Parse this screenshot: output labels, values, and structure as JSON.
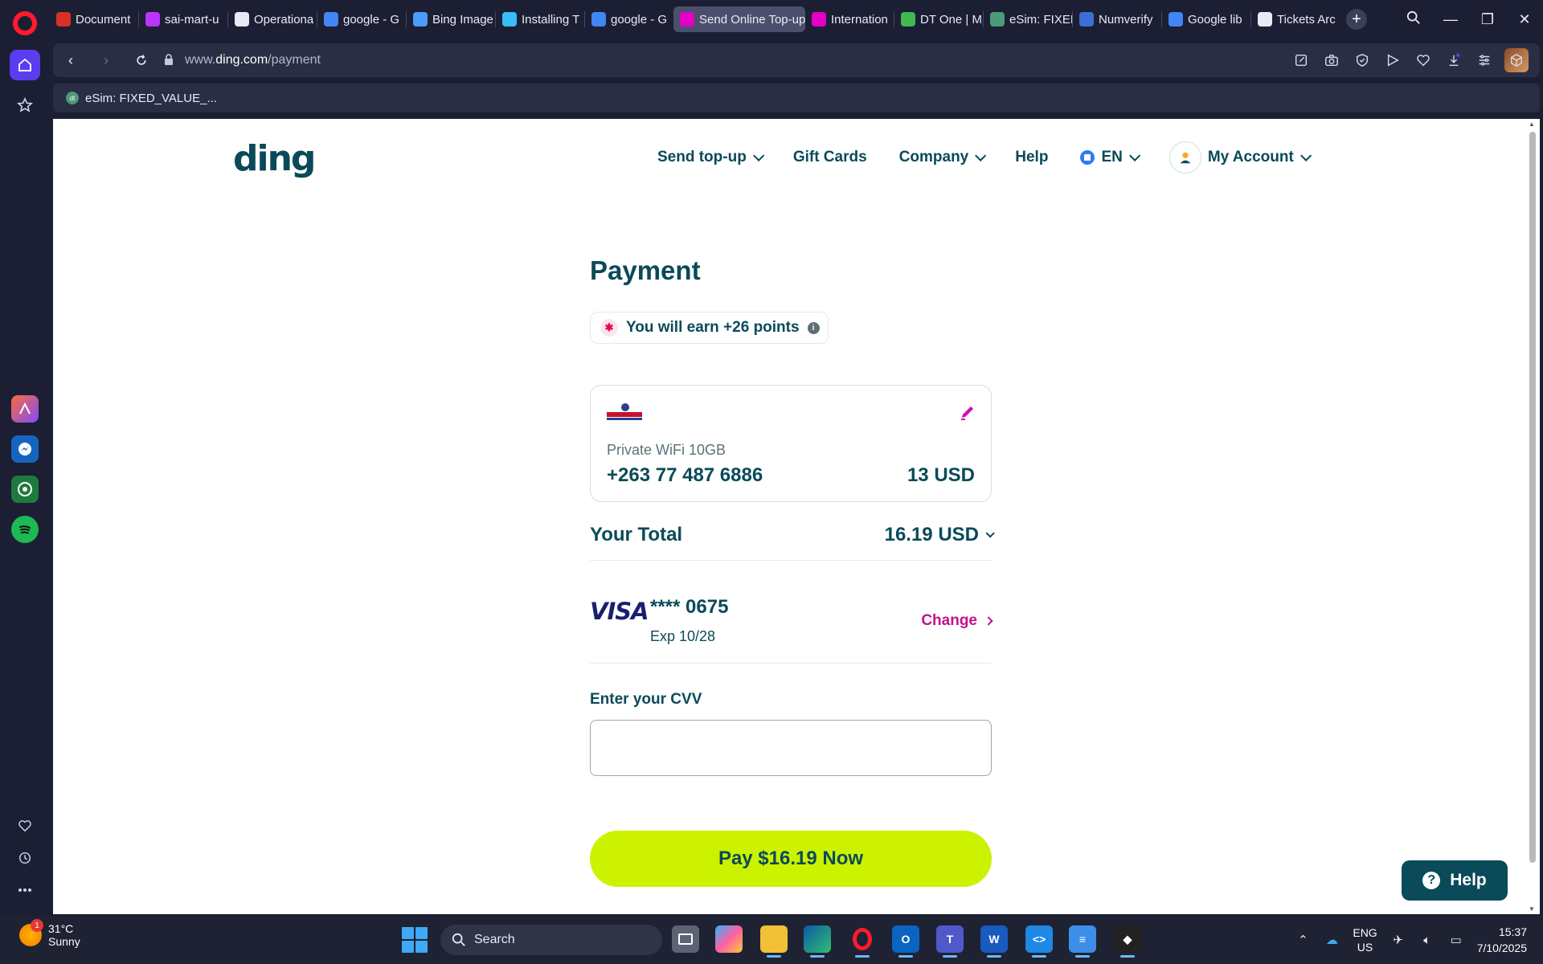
{
  "browser": {
    "tabs": [
      {
        "label": "Document",
        "favicon": "gmail-icon",
        "color": "#d93025"
      },
      {
        "label": "sai-mart-u",
        "favicon": "vite-icon",
        "color": "#bd34fe"
      },
      {
        "label": "Operationa",
        "favicon": "document-icon",
        "color": "#e8eaf6"
      },
      {
        "label": "google - G",
        "favicon": "google-icon",
        "color": "#4285f4"
      },
      {
        "label": "Bing Image",
        "favicon": "bing-search-icon",
        "color": "#4a9cff"
      },
      {
        "label": "Installing T",
        "favicon": "tailwind-icon",
        "color": "#38bdf8"
      },
      {
        "label": "google - G",
        "favicon": "google-icon",
        "color": "#4285f4"
      },
      {
        "label": "Send Online Top-up",
        "favicon": "ding-icon",
        "color": "#e100c6",
        "active": true
      },
      {
        "label": "Internation",
        "favicon": "ding-icon",
        "color": "#e100c6"
      },
      {
        "label": "DT One | M",
        "favicon": "dtone-icon",
        "color": "#3fb950"
      },
      {
        "label": "eSim: FIXED",
        "favicon": "dtone-icon",
        "color": "#4c9a7a"
      },
      {
        "label": "Numverify",
        "favicon": "phone-icon",
        "color": "#3b6fd4"
      },
      {
        "label": "Google lib",
        "favicon": "google-icon",
        "color": "#4285f4"
      },
      {
        "label": "Tickets Arc",
        "favicon": "tickets-icon",
        "color": "#e8eaf6"
      }
    ],
    "url_prefix": "www.",
    "url_domain": "ding.com",
    "url_path": "/payment",
    "bookmark": "eSim: FIXED_VALUE_..."
  },
  "site": {
    "logo": "ding",
    "nav": {
      "send_topup": "Send top-up",
      "gift_cards": "Gift Cards",
      "company": "Company",
      "help": "Help",
      "language": "EN",
      "account": "My Account"
    }
  },
  "payment": {
    "title": "Payment",
    "points_text": "You will earn +26 points",
    "product": {
      "operator_logo": "econet-icon",
      "name": "Private WiFi 10GB",
      "phone": "+263 77 487 6886",
      "amount": "13 USD"
    },
    "total_label": "Your Total",
    "total_value": "16.19 USD",
    "card": {
      "brand": "VISA",
      "masked_number": "**** 0675",
      "expiry": "Exp 10/28",
      "change_label": "Change"
    },
    "cvv_label": "Enter your CVV",
    "cvv_value": "",
    "pay_button": "Pay $16.19 Now",
    "help_button": "Help"
  },
  "colors": {
    "brand_teal": "#0a4a59",
    "accent_lime": "#ccf200",
    "accent_magenta": "#c2128f"
  },
  "taskbar": {
    "weather_temp": "31°C",
    "weather_desc": "Sunny",
    "weather_badge": "1",
    "search_placeholder": "Search",
    "lang_1": "ENG",
    "lang_2": "US",
    "time": "15:37",
    "date": "7/10/2025"
  }
}
